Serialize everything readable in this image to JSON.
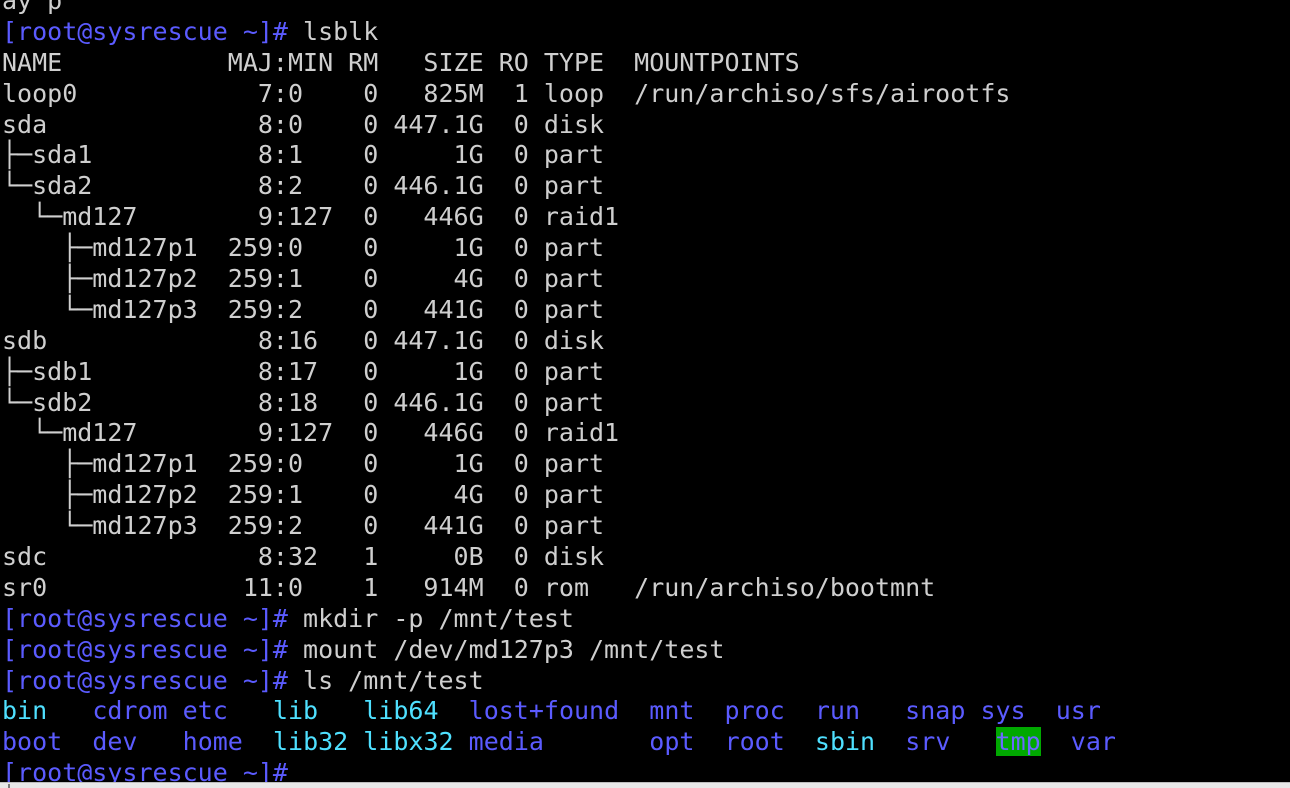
{
  "terminal": {
    "background": "#000000",
    "foreground": "#cfcfcf",
    "prompt_color": "#5b5bff",
    "dir_color": "#5b5bff",
    "cyan_color": "#4fe0ff",
    "tmp_bg_color": "#00a800",
    "lines": [
      [
        {
          "t": "ay p",
          "c": "partial"
        }
      ],
      [
        {
          "t": "[root@sysrescue ~]# ",
          "c": "prompt"
        },
        {
          "t": "lsblk",
          "c": ""
        }
      ],
      [
        {
          "t": "NAME           MAJ:MIN RM   SIZE RO TYPE  MOUNTPOINTS",
          "c": ""
        }
      ],
      [
        {
          "t": "loop0            7:0    0   825M  1 loop  /run/archiso/sfs/airootfs",
          "c": ""
        }
      ],
      [
        {
          "t": "sda              8:0    0 447.1G  0 disk",
          "c": ""
        }
      ],
      [
        {
          "t": "├─sda1           8:1    0     1G  0 part",
          "c": ""
        }
      ],
      [
        {
          "t": "└─sda2           8:2    0 446.1G  0 part",
          "c": ""
        }
      ],
      [
        {
          "t": "  └─md127        9:127  0   446G  0 raid1",
          "c": ""
        }
      ],
      [
        {
          "t": "    ├─md127p1  259:0    0     1G  0 part",
          "c": ""
        }
      ],
      [
        {
          "t": "    ├─md127p2  259:1    0     4G  0 part",
          "c": ""
        }
      ],
      [
        {
          "t": "    └─md127p3  259:2    0   441G  0 part",
          "c": ""
        }
      ],
      [
        {
          "t": "sdb              8:16   0 447.1G  0 disk",
          "c": ""
        }
      ],
      [
        {
          "t": "├─sdb1           8:17   0     1G  0 part",
          "c": ""
        }
      ],
      [
        {
          "t": "└─sdb2           8:18   0 446.1G  0 part",
          "c": ""
        }
      ],
      [
        {
          "t": "  └─md127        9:127  0   446G  0 raid1",
          "c": ""
        }
      ],
      [
        {
          "t": "    ├─md127p1  259:0    0     1G  0 part",
          "c": ""
        }
      ],
      [
        {
          "t": "    ├─md127p2  259:1    0     4G  0 part",
          "c": ""
        }
      ],
      [
        {
          "t": "    └─md127p3  259:2    0   441G  0 part",
          "c": ""
        }
      ],
      [
        {
          "t": "sdc              8:32   1     0B  0 disk",
          "c": ""
        }
      ],
      [
        {
          "t": "sr0             11:0    1   914M  0 rom   /run/archiso/bootmnt",
          "c": ""
        }
      ],
      [
        {
          "t": "[root@sysrescue ~]# ",
          "c": "prompt"
        },
        {
          "t": "mkdir -p /mnt/test",
          "c": ""
        }
      ],
      [
        {
          "t": "[root@sysrescue ~]# ",
          "c": "prompt"
        },
        {
          "t": "mount /dev/md127p3 /mnt/test",
          "c": ""
        }
      ],
      [
        {
          "t": "[root@sysrescue ~]# ",
          "c": "prompt"
        },
        {
          "t": "ls /mnt/test",
          "c": ""
        }
      ],
      [
        {
          "t": "bin",
          "c": "cyan"
        },
        {
          "t": "   ",
          "c": ""
        },
        {
          "t": "cdrom",
          "c": "dir"
        },
        {
          "t": " ",
          "c": ""
        },
        {
          "t": "etc",
          "c": "dir"
        },
        {
          "t": "   ",
          "c": ""
        },
        {
          "t": "lib",
          "c": "cyan"
        },
        {
          "t": "   ",
          "c": ""
        },
        {
          "t": "lib64",
          "c": "cyan"
        },
        {
          "t": "  ",
          "c": ""
        },
        {
          "t": "lost+found",
          "c": "dir"
        },
        {
          "t": "  ",
          "c": ""
        },
        {
          "t": "mnt",
          "c": "dir"
        },
        {
          "t": "  ",
          "c": ""
        },
        {
          "t": "proc",
          "c": "dir"
        },
        {
          "t": "  ",
          "c": ""
        },
        {
          "t": "run",
          "c": "dir"
        },
        {
          "t": "   ",
          "c": ""
        },
        {
          "t": "snap",
          "c": "dir"
        },
        {
          "t": " ",
          "c": ""
        },
        {
          "t": "sys",
          "c": "dir"
        },
        {
          "t": "  ",
          "c": ""
        },
        {
          "t": "usr",
          "c": "dir"
        }
      ],
      [
        {
          "t": "boot",
          "c": "dir"
        },
        {
          "t": "  ",
          "c": ""
        },
        {
          "t": "dev",
          "c": "dir"
        },
        {
          "t": "   ",
          "c": ""
        },
        {
          "t": "home",
          "c": "dir"
        },
        {
          "t": "  ",
          "c": ""
        },
        {
          "t": "lib32",
          "c": "cyan"
        },
        {
          "t": " ",
          "c": ""
        },
        {
          "t": "libx32",
          "c": "cyan"
        },
        {
          "t": " ",
          "c": ""
        },
        {
          "t": "media",
          "c": "dir"
        },
        {
          "t": "       ",
          "c": ""
        },
        {
          "t": "opt",
          "c": "dir"
        },
        {
          "t": "  ",
          "c": ""
        },
        {
          "t": "root",
          "c": "dir"
        },
        {
          "t": "  ",
          "c": ""
        },
        {
          "t": "sbin",
          "c": "cyan"
        },
        {
          "t": "  ",
          "c": ""
        },
        {
          "t": "srv",
          "c": "dir"
        },
        {
          "t": "   ",
          "c": ""
        },
        {
          "t": "tmp",
          "c": "tmp"
        },
        {
          "t": "  ",
          "c": ""
        },
        {
          "t": "var",
          "c": "dir"
        }
      ],
      [
        {
          "t": "[root@sysrescue ~]# ",
          "c": "prompt"
        }
      ]
    ]
  }
}
